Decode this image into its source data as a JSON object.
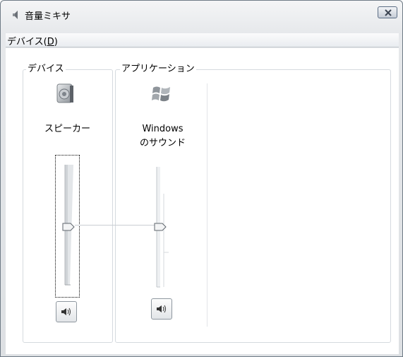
{
  "window": {
    "title": "音量ミキサ",
    "title_icon": "speaker-icon",
    "close_icon": "close-icon"
  },
  "menu": {
    "device_prefix": "デバイス(",
    "device_accel": "D",
    "device_suffix": ")"
  },
  "groups": {
    "device_label": "デバイス",
    "application_label": "アプリケーション"
  },
  "channels": [
    {
      "name": "スピーカー",
      "icon": "speaker-device-icon",
      "volume_fraction": 0.6,
      "muted": false
    },
    {
      "name_line1": "Windows",
      "name_line2": "のサウンド",
      "icon": "windows-logo-icon",
      "volume_fraction": 0.55,
      "muted": false
    }
  ]
}
